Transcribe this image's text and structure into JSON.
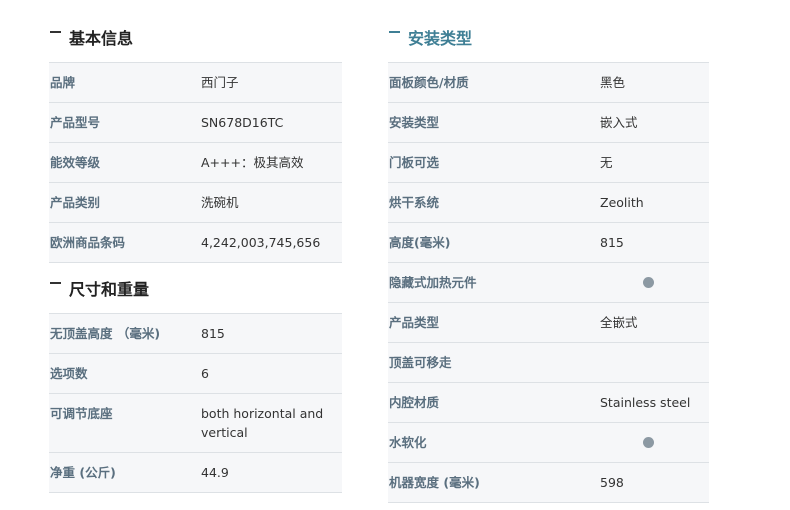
{
  "basic_info": {
    "title": "基本信息",
    "rows": [
      {
        "label": "品牌",
        "value": "西门子"
      },
      {
        "label": "产品型号",
        "value": "SN678D16TC"
      },
      {
        "label": "能效等级",
        "value": "A+++：极其高效"
      },
      {
        "label": "产品类别",
        "value": "洗碗机"
      },
      {
        "label": "欧洲商品条码",
        "value": "4,242,003,745,656"
      }
    ]
  },
  "size_weight": {
    "title": "尺寸和重量",
    "rows": [
      {
        "label": "无顶盖高度 （毫米)",
        "value": "815"
      },
      {
        "label": "选项数",
        "value": "6"
      },
      {
        "label": "可调节底座",
        "value": "both horizontal and vertical"
      },
      {
        "label": "净重 (公斤)",
        "value": "44.9"
      }
    ]
  },
  "install_type": {
    "title": "安装类型",
    "rows": [
      {
        "label": "面板颜色/材质",
        "value": "黑色"
      },
      {
        "label": "安装类型",
        "value": "嵌入式"
      },
      {
        "label": "门板可选",
        "value": "无"
      },
      {
        "label": "烘干系统",
        "value": "Zeolith"
      },
      {
        "label": "高度(毫米)",
        "value": "815"
      },
      {
        "label": "隐藏式加热元件",
        "value": "",
        "indicator": "dot-icon"
      },
      {
        "label": "产品类型",
        "value": "全嵌式"
      },
      {
        "label": "顶盖可移走",
        "value": ""
      },
      {
        "label": "内腔材质",
        "value": "Stainless steel"
      },
      {
        "label": "水软化",
        "value": "",
        "indicator": "dot-icon"
      },
      {
        "label": "机器宽度 (毫米)",
        "value": "598"
      }
    ]
  },
  "colors": {
    "accent": "#3f7f95",
    "label": "#5a6f7f",
    "row_bg": "#f6f7f9",
    "dot": "#8c99a3"
  }
}
